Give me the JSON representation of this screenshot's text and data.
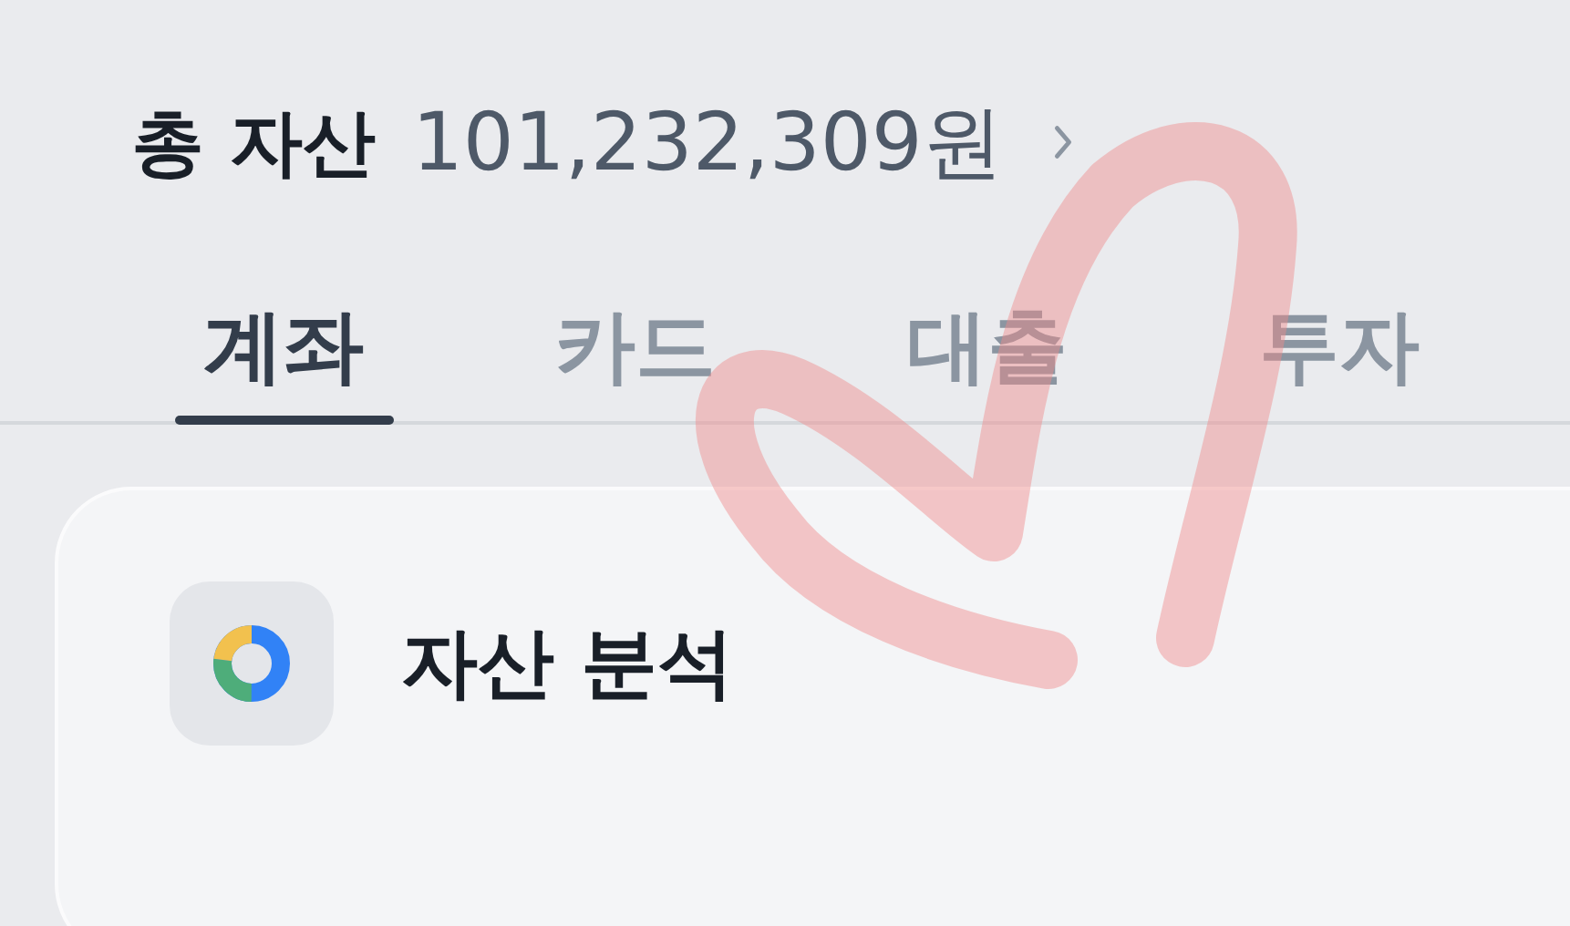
{
  "header": {
    "title": "총 자산",
    "amount": "101,232,309원"
  },
  "tabs": [
    {
      "label": "계좌",
      "selected": true
    },
    {
      "label": "카드",
      "selected": false
    },
    {
      "label": "대출",
      "selected": false
    },
    {
      "label": "투자",
      "selected": false
    }
  ],
  "card": {
    "title": "자산 분석"
  },
  "scribble": {
    "kind": "heart"
  }
}
